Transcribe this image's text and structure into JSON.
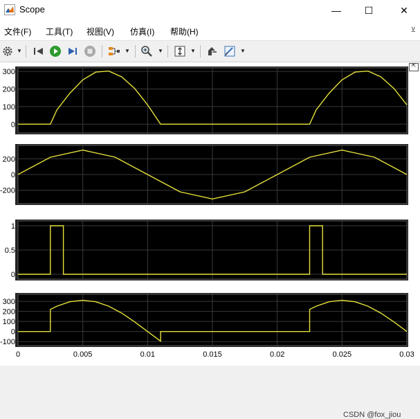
{
  "window": {
    "title": "Scope",
    "minimize": "—",
    "maximize": "☐",
    "close": "✕"
  },
  "menu": [
    "文件(F)",
    "工具(T)",
    "视图(V)",
    "仿真(I)",
    "帮助(H)"
  ],
  "toolbar": {
    "icons": [
      "gear-icon",
      "step-back-icon",
      "run-icon",
      "step-forward-icon",
      "stop-icon",
      "signal-select-icon",
      "zoom-icon",
      "autoscale-icon",
      "highlight-icon",
      "style-icon"
    ]
  },
  "colors": {
    "plot_bg": "#000000",
    "panel_bg": "#232323",
    "trace": "#e6e23a",
    "grid": "#3a3a3a",
    "axis_text": "#000000"
  },
  "watermark": "CSDN @fox_jiou",
  "chart_data": [
    {
      "type": "line",
      "name": "panel-1",
      "xlim": [
        0,
        0.03
      ],
      "ylim": [
        -50,
        320
      ],
      "yticks": [
        0,
        100,
        200,
        300
      ],
      "series": [
        {
          "x": [
            0,
            0.0025,
            0.003,
            0.004,
            0.005,
            0.006,
            0.007,
            0.008,
            0.009,
            0.01,
            0.011,
            0.0225,
            0.023,
            0.024,
            0.025,
            0.026,
            0.027,
            0.028,
            0.029,
            0.03
          ],
          "y": [
            0,
            0,
            81,
            176,
            252,
            296,
            302,
            269,
            203,
            110,
            0,
            0,
            81,
            176,
            252,
            296,
            302,
            269,
            203,
            110
          ]
        }
      ]
    },
    {
      "type": "line",
      "name": "panel-2",
      "xlim": [
        0,
        0.03
      ],
      "ylim": [
        -370,
        370
      ],
      "yticks": [
        -200,
        0,
        200
      ],
      "series": [
        {
          "x": [
            0,
            0.0025,
            0.005,
            0.0075,
            0.01,
            0.0125,
            0.015,
            0.0175,
            0.02,
            0.0225,
            0.025,
            0.0275,
            0.03
          ],
          "y": [
            0,
            220,
            311,
            220,
            0,
            -220,
            -311,
            -220,
            0,
            220,
            311,
            220,
            0
          ]
        }
      ]
    },
    {
      "type": "line",
      "name": "panel-3",
      "xlim": [
        0,
        0.03
      ],
      "ylim": [
        -0.1,
        1.1
      ],
      "yticks": [
        0,
        0.5,
        1
      ],
      "series": [
        {
          "x": [
            0,
            0.0025,
            0.0025,
            0.0035,
            0.0035,
            0.0225,
            0.0225,
            0.0235,
            0.0235,
            0.03
          ],
          "y": [
            0,
            0,
            1,
            1,
            0,
            0,
            1,
            1,
            0,
            0
          ]
        }
      ]
    },
    {
      "type": "line",
      "name": "panel-4",
      "xlim": [
        0,
        0.03
      ],
      "ylim": [
        -140,
        370
      ],
      "yticks": [
        -100,
        0,
        100,
        200,
        300
      ],
      "xticks": [
        0,
        0.005,
        0.01,
        0.015,
        0.02,
        0.025,
        0.03
      ],
      "xtick_labels": [
        "0",
        "0.005",
        "0.01",
        "0.015",
        "0.02",
        "0.025",
        "0.03"
      ],
      "series": [
        {
          "x": [
            0,
            0.0025,
            0.0025,
            0.003,
            0.004,
            0.005,
            0.006,
            0.007,
            0.008,
            0.009,
            0.01,
            0.011,
            0.011,
            0.0225,
            0.0225,
            0.023,
            0.024,
            0.025,
            0.026,
            0.027,
            0.028,
            0.029,
            0.03
          ],
          "y": [
            0,
            0,
            220,
            252,
            296,
            311,
            296,
            252,
            183,
            96,
            0,
            -96,
            0,
            0,
            220,
            252,
            296,
            311,
            296,
            252,
            183,
            96,
            0
          ]
        }
      ]
    }
  ]
}
